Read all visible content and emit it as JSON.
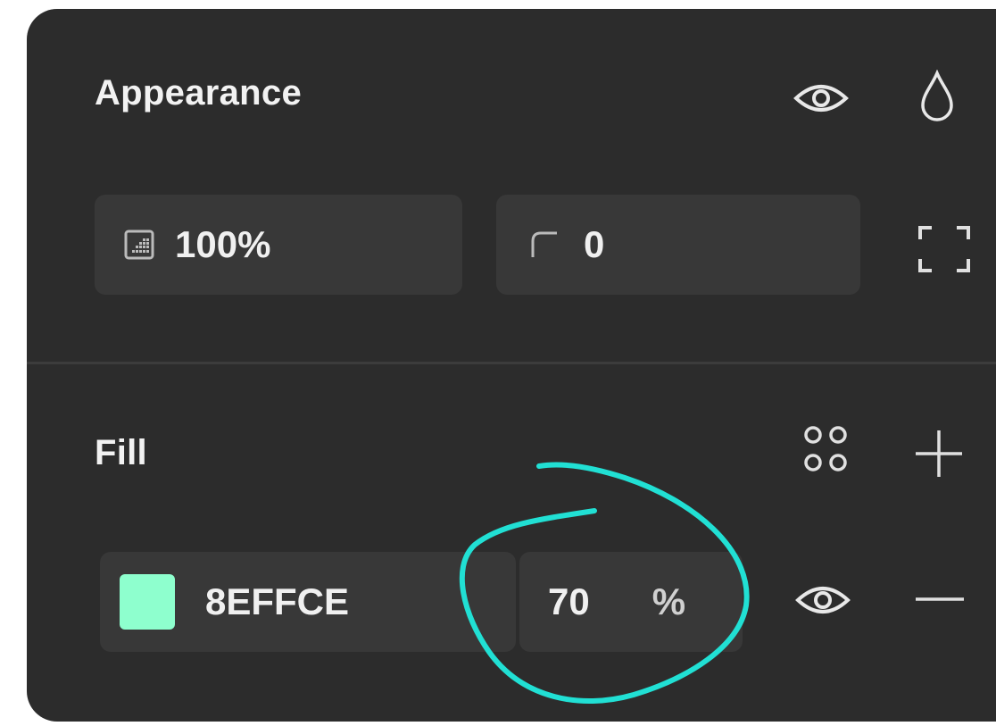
{
  "appearance": {
    "title": "Appearance",
    "opacity_value": "100%",
    "radius_value": "0"
  },
  "fill": {
    "title": "Fill",
    "color_hex": "8EFFCE",
    "swatch_color": "#8EFFCE",
    "opacity_value": "70",
    "opacity_unit": "%"
  },
  "icons": {
    "visibility": "eye-icon",
    "blend": "drop-icon",
    "opacity": "opacity-grid-icon",
    "corner": "corner-radius-icon",
    "independent_corners": "expand-corners-icon",
    "styles": "styles-grid-icon",
    "add": "plus-icon",
    "fill_visibility": "eye-icon",
    "remove": "minus-icon"
  },
  "colors": {
    "panel_bg": "#2c2c2c",
    "field_bg": "#383838",
    "text": "#f0f0f0",
    "annotation": "#21e0d4"
  }
}
